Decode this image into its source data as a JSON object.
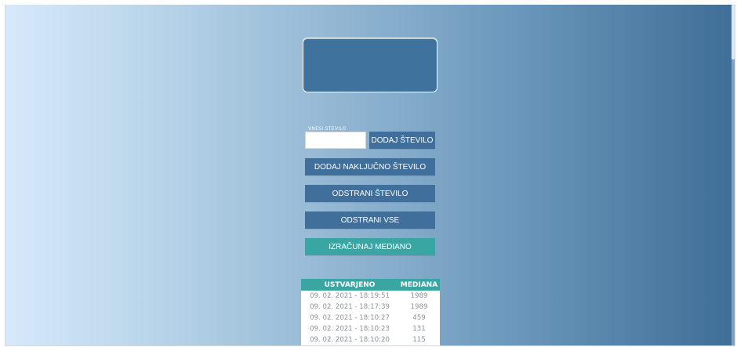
{
  "display": {
    "value": ""
  },
  "input": {
    "label": "VNESI ŠTEVILO",
    "value": "",
    "placeholder": ""
  },
  "buttons": {
    "add_number": "DODAJ ŠTEVILO",
    "add_random": "DODAJ NAKLJUČNO ŠTEVILO",
    "remove_number": "ODSTRANI ŠTEVILO",
    "remove_all": "ODSTRANI VSE",
    "calculate_median": "IZRAČUNAJ MEDIANO"
  },
  "history": {
    "headers": [
      "USTVARJENO",
      "MEDIANA"
    ],
    "rows": [
      {
        "created": "09. 02. 2021 - 18:19:51",
        "median": "1989"
      },
      {
        "created": "09. 02. 2021 - 18:17:39",
        "median": "1989"
      },
      {
        "created": "09. 02. 2021 - 18:10:27",
        "median": "459"
      },
      {
        "created": "09. 02. 2021 - 18:10:23",
        "median": "131"
      },
      {
        "created": "09. 02. 2021 - 18:10:20",
        "median": "115"
      }
    ]
  },
  "colors": {
    "primary_button": "#3f6f9a",
    "accent_teal": "#3aa6a4",
    "display_box": "#3f729d",
    "gradient_left": "#d7e9fb",
    "gradient_right": "#3f6e96"
  }
}
